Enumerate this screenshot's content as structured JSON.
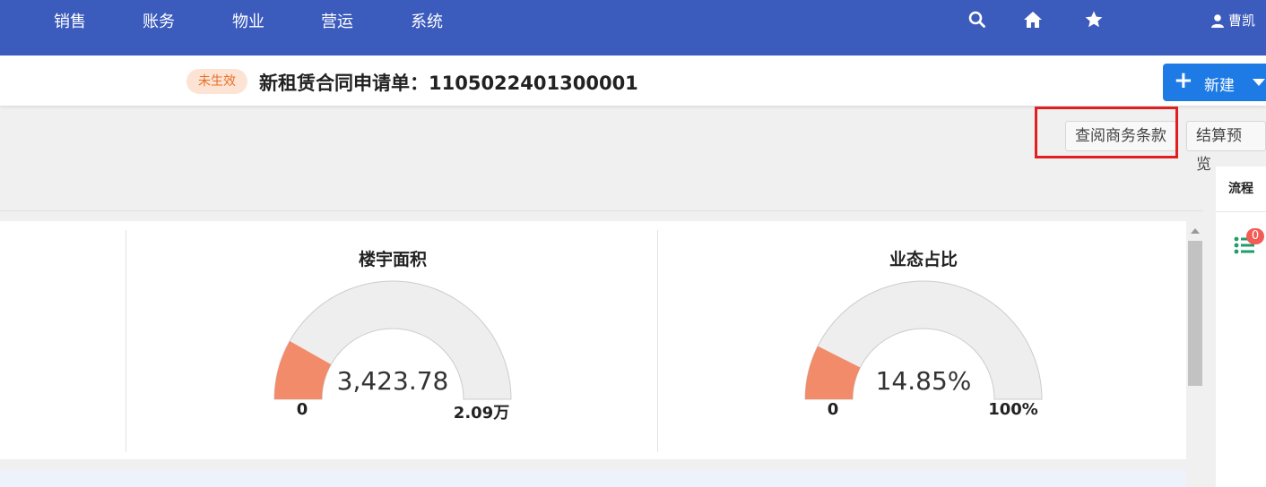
{
  "nav": {
    "items": [
      "销售",
      "账务",
      "物业",
      "营运",
      "系统"
    ]
  },
  "user": {
    "name": "曹凯"
  },
  "header": {
    "status": "未生效",
    "title": "新租赁合同申请单：1105022401300001",
    "new_button": "新建"
  },
  "actions": {
    "view_terms": "查阅商务条款",
    "settlement_preview": "结算预览"
  },
  "gauges": [
    {
      "title": "楼宇面积",
      "value": "3,423.78",
      "min": "0",
      "max": "2.09万",
      "fraction": 0.164
    },
    {
      "title": "业态占比",
      "value": "14.85%",
      "min": "0",
      "max": "100%",
      "fraction": 0.1485
    }
  ],
  "side_panel": {
    "tab": "流程",
    "badge": "0"
  },
  "colors": {
    "topbar": "#3b5bbd",
    "accent": "#1e7be6",
    "gauge_fill": "#f28b6a",
    "gauge_track": "#eeeeee",
    "highlight": "#e02020"
  }
}
